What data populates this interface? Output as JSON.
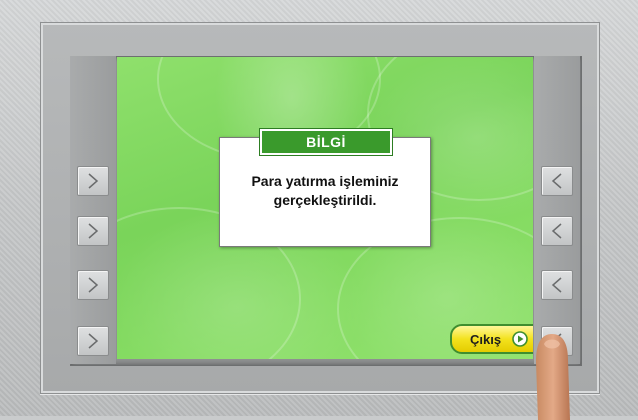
{
  "dialog": {
    "title": "BİLGİ",
    "message": "Para yatırma işleminiz gerçekleştirildi."
  },
  "exit": {
    "label": "Çıkış",
    "icon": "play-circle-icon"
  },
  "left_buttons": [
    {
      "icon": "chevron-right-icon"
    },
    {
      "icon": "chevron-right-icon"
    },
    {
      "icon": "chevron-right-icon"
    },
    {
      "icon": "chevron-right-icon"
    }
  ],
  "right_buttons": [
    {
      "icon": "chevron-left-icon"
    },
    {
      "icon": "chevron-left-icon"
    },
    {
      "icon": "chevron-left-icon"
    },
    {
      "icon": "chevron-left-icon"
    }
  ],
  "colors": {
    "screen_green": "#7ad45a",
    "title_green": "#3a9a2c",
    "exit_yellow": "#f3e21e"
  }
}
